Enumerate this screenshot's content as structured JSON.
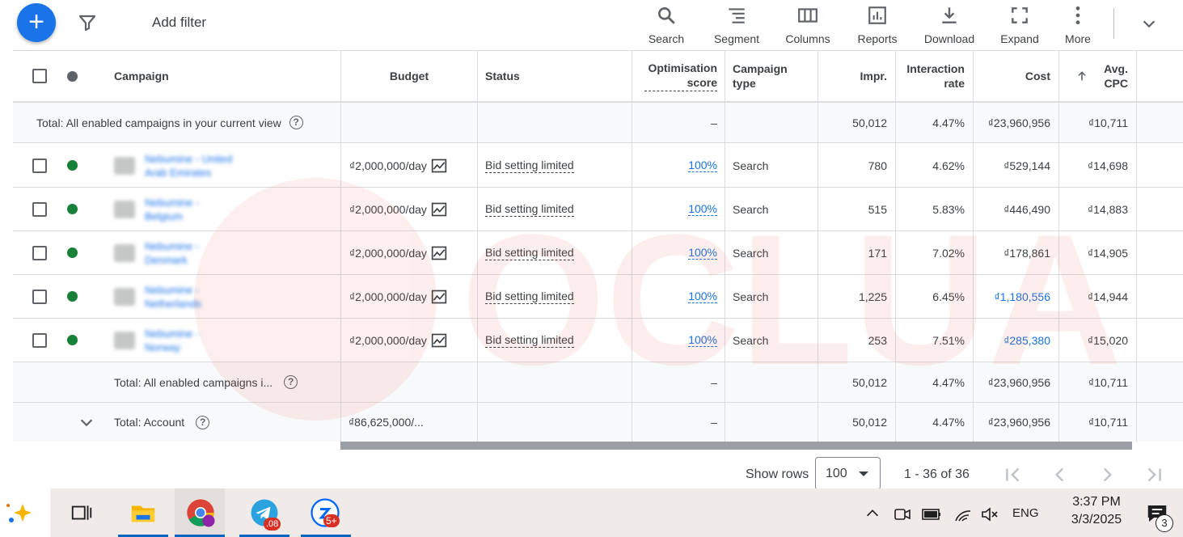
{
  "toolbar": {
    "add_filter": "Add filter",
    "buttons": [
      {
        "label": "Search",
        "icon": "search-icon"
      },
      {
        "label": "Segment",
        "icon": "segment-icon"
      },
      {
        "label": "Columns",
        "icon": "columns-icon"
      },
      {
        "label": "Reports",
        "icon": "reports-icon"
      },
      {
        "label": "Download",
        "icon": "download-icon"
      },
      {
        "label": "Expand",
        "icon": "expand-icon"
      },
      {
        "label": "More",
        "icon": "more-icon"
      }
    ]
  },
  "table": {
    "headers": {
      "campaign": "Campaign",
      "budget": "Budget",
      "status": "Status",
      "opt_score": "Optimisation score",
      "campaign_type": "Campaign type",
      "impr": "Impr.",
      "interaction_rate": "Interaction rate",
      "cost": "Cost",
      "avg_cpc": "Avg. CPC"
    },
    "total_top": {
      "label": "Total: All enabled campaigns in your current view",
      "opt": "–",
      "impr": "50,012",
      "rate": "4.47%",
      "cost": "₫23,960,956",
      "cpc": "₫10,711"
    },
    "rows": [
      {
        "name_line1": "Nebumine - United",
        "name_line2": "Arab Emirates",
        "budget": "₫2,000,000/day",
        "status": "Bid setting limited",
        "opt": "100%",
        "type": "Search",
        "impr": "780",
        "rate": "4.62%",
        "cost": "₫529,144",
        "cpc": "₫14,698"
      },
      {
        "name_line1": "Nebumine -",
        "name_line2": "Belgium",
        "budget": "₫2,000,000/day",
        "status": "Bid setting limited",
        "opt": "100%",
        "type": "Search",
        "impr": "515",
        "rate": "5.83%",
        "cost": "₫446,490",
        "cpc": "₫14,883"
      },
      {
        "name_line1": "Nebumine -",
        "name_line2": "Denmark",
        "budget": "₫2,000,000/day",
        "status": "Bid setting limited",
        "opt": "100%",
        "type": "Search",
        "impr": "171",
        "rate": "7.02%",
        "cost": "₫178,861",
        "cpc": "₫14,905"
      },
      {
        "name_line1": "Nebumine -",
        "name_line2": "Netherlands",
        "budget": "₫2,000,000/day",
        "status": "Bid setting limited",
        "opt": "100%",
        "type": "Search",
        "impr": "1,225",
        "rate": "6.45%",
        "cost": "₫1,180,556",
        "cpc": "₫14,944"
      },
      {
        "name_line1": "Nebumine -",
        "name_line2": "Norway",
        "budget": "₫2,000,000/day",
        "status": "Bid setting limited",
        "opt": "100%",
        "type": "Search",
        "impr": "253",
        "rate": "7.51%",
        "cost": "₫285,380",
        "cpc": "₫15,020"
      }
    ],
    "total_bottom": {
      "label": "Total: All enabled campaigns i...",
      "opt": "–",
      "impr": "50,012",
      "rate": "4.47%",
      "cost": "₫23,960,956",
      "cpc": "₫10,711"
    },
    "total_account": {
      "label": "Total: Account",
      "budget": "₫86,625,000/...",
      "opt": "–",
      "impr": "50,012",
      "rate": "4.47%",
      "cost": "₫23,960,956",
      "cpc": "₫10,711"
    }
  },
  "pagination": {
    "show_rows_label": "Show rows",
    "rows_value": "100",
    "range": "1 - 36 of 36"
  },
  "watermark": "OCLUA",
  "taskbar": {
    "telegram_badge": ".08",
    "zalo_badge": "5+",
    "lang": "ENG",
    "time": "3:37 PM",
    "date": "3/3/2025",
    "notif_count": "3"
  },
  "colors": {
    "accent": "#1a73e8",
    "enabled_dot": "#188038",
    "watermark": "#e8503a"
  }
}
